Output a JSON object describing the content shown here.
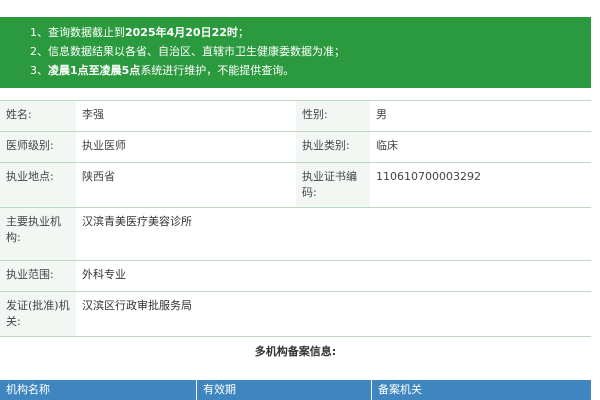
{
  "notice": {
    "line1_prefix": "1、查询数据截止到",
    "line1_bold": "2025年4月20日22时",
    "line1_suffix": "；",
    "line2": "2、信息数据结果以各省、自治区、直辖市卫生健康委数据为准；",
    "line3_prefix": "3、",
    "line3_bold1": "凌晨1点至凌晨5点",
    "line3_suffix": "系统进行维护，不能提供查询。"
  },
  "info": {
    "name_label": "姓名:",
    "name_value": "李强",
    "gender_label": "性别:",
    "gender_value": "男",
    "level_label": "医师级别:",
    "level_value": "执业医师",
    "category_label": "执业类别:",
    "category_value": "临床",
    "location_label": "执业地点:",
    "location_value": "陕西省",
    "cert_label": "执业证书编码:",
    "cert_value": "110610700003292",
    "institution_label": "主要执业机构:",
    "institution_value": "汉滨青美医疗美容诊所",
    "scope_label": "执业范围:",
    "scope_value": "外科专业",
    "issuer_label": "发证(批准)机关:",
    "issuer_value": "汉滨区行政审批服务局"
  },
  "multi": {
    "title": "多机构备案信息:",
    "columns": [
      "机构名称",
      "有效期",
      "备案机关"
    ]
  },
  "colors": {
    "notice_bg": "#2b9a3e",
    "label_bg": "#f3f7f4",
    "header_bg": "#3f86c1"
  }
}
